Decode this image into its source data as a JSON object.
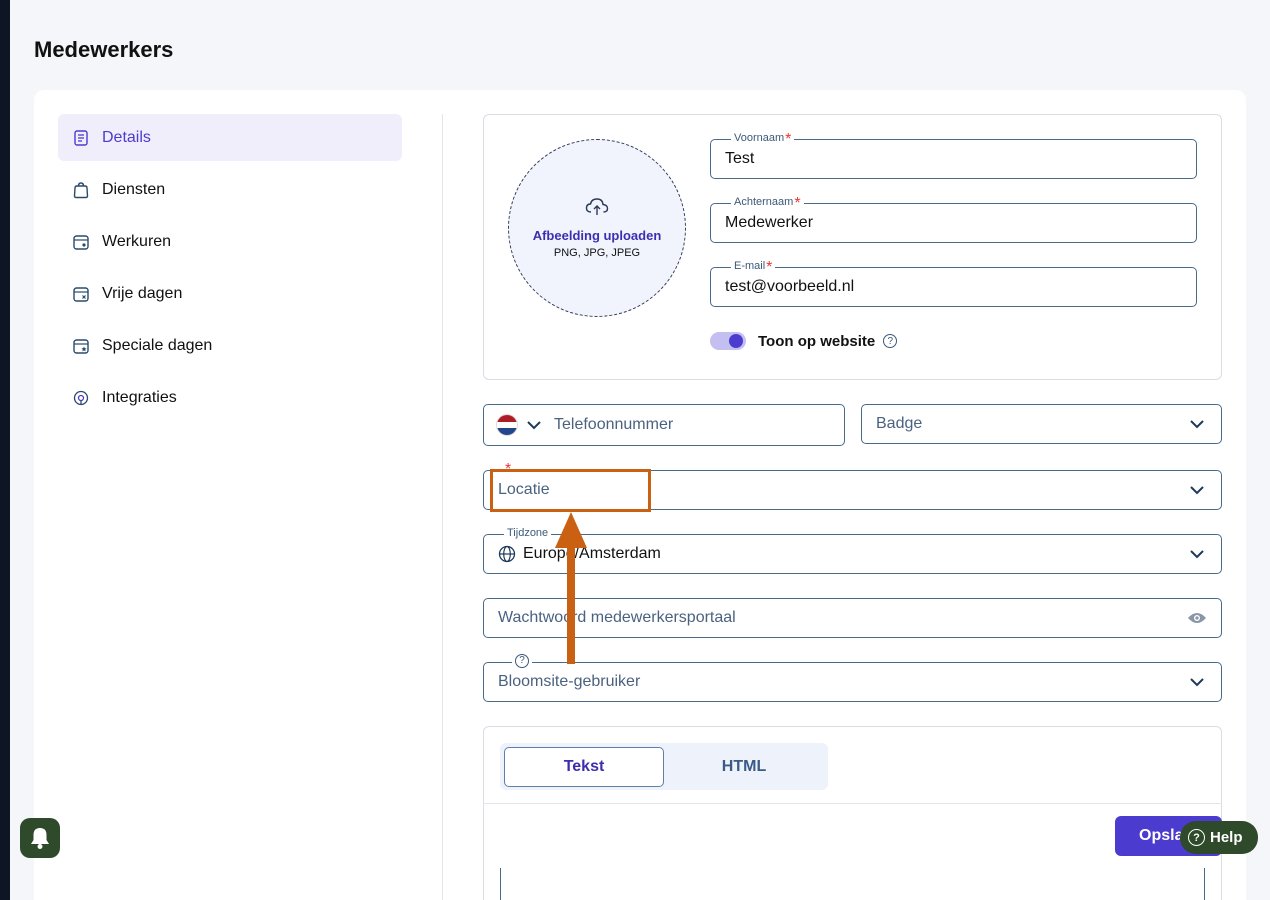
{
  "page": {
    "title": "Medewerkers"
  },
  "nav": {
    "items": [
      {
        "label": "Details",
        "icon": "document-icon",
        "active": true
      },
      {
        "label": "Diensten",
        "icon": "bag-icon"
      },
      {
        "label": "Werkuren",
        "icon": "calendar-clock-icon"
      },
      {
        "label": "Vrije dagen",
        "icon": "calendar-x-icon"
      },
      {
        "label": "Speciale dagen",
        "icon": "calendar-star-icon"
      },
      {
        "label": "Integraties",
        "icon": "integration-icon"
      }
    ]
  },
  "upload": {
    "title": "Afbeelding uploaden",
    "formats": "PNG, JPG, JPEG"
  },
  "form": {
    "first_name": {
      "label": "Voornaam",
      "value": "Test",
      "required": "*"
    },
    "last_name": {
      "label": "Achternaam",
      "value": "Medewerker",
      "required": "*"
    },
    "email": {
      "label": "E-mail",
      "value": "test@voorbeeld.nl",
      "required": "*"
    },
    "show_on_website": {
      "label": "Toon op website",
      "help": "?",
      "on": true
    },
    "phone": {
      "placeholder": "Telefoonnummer",
      "country": "NL"
    },
    "badge": {
      "placeholder": "Badge"
    },
    "location": {
      "placeholder": "Locatie",
      "required": "*"
    },
    "timezone": {
      "label": "Tijdzone",
      "value": "Europe/Amsterdam"
    },
    "password": {
      "placeholder": "Wachtwoord medewerkersportaal"
    },
    "bloomsite_user": {
      "placeholder": "Bloomsite-gebruiker",
      "help": "?"
    }
  },
  "editor": {
    "tabs": [
      {
        "label": "Tekst",
        "active": true
      },
      {
        "label": "HTML"
      }
    ]
  },
  "actions": {
    "save": "Opslaan",
    "help": "Help",
    "help_icon": "?"
  },
  "colors": {
    "accent": "#4c3bcf",
    "annotation": "#c96012",
    "help_bg": "#2e4a2a"
  }
}
